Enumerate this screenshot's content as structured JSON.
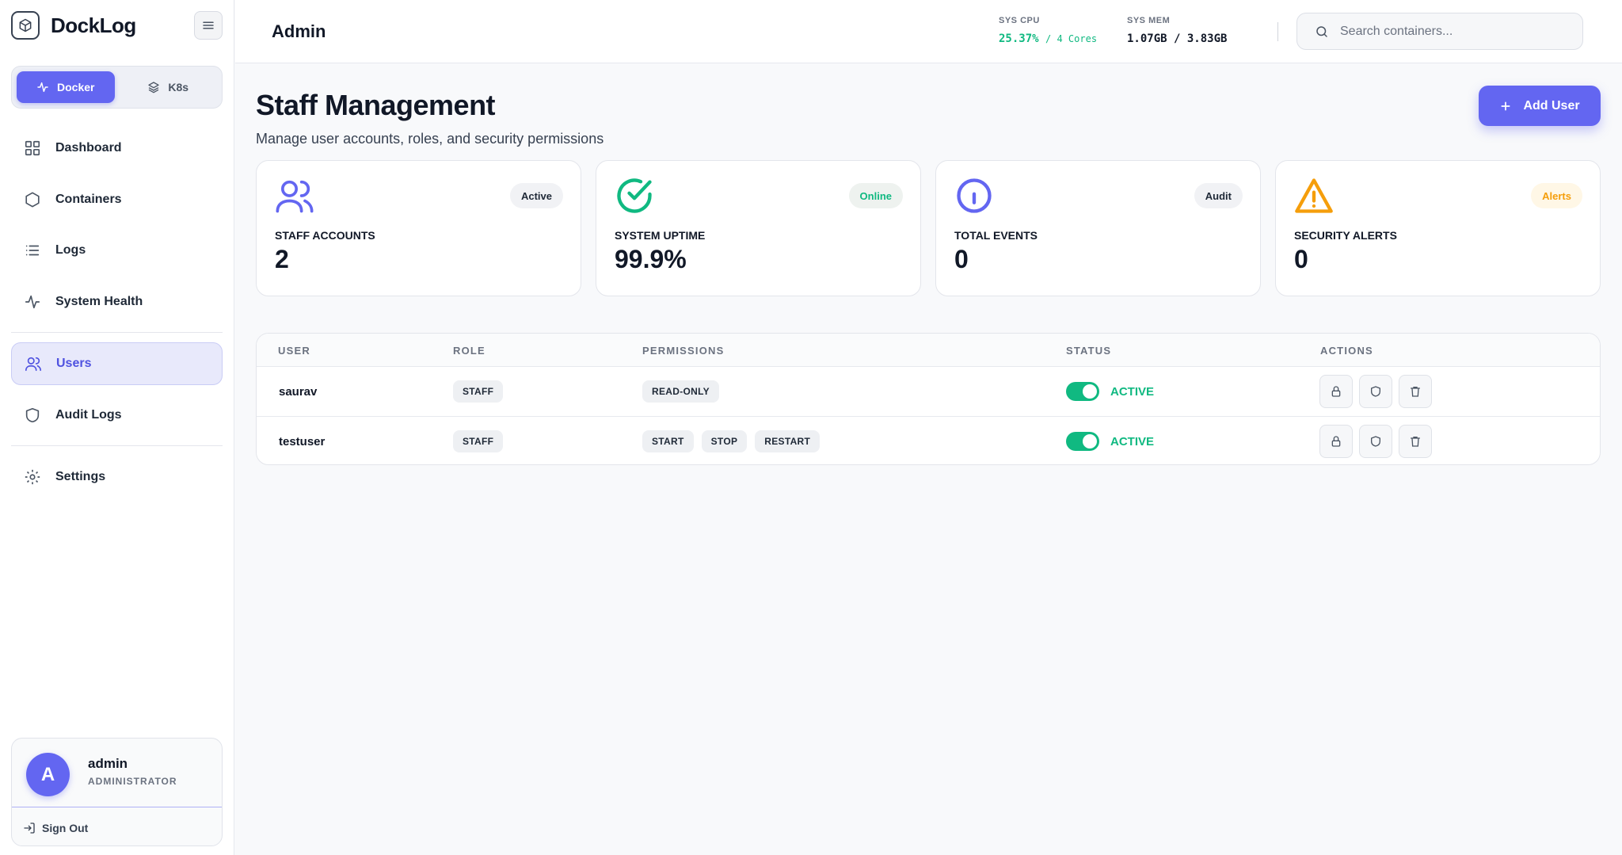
{
  "brand": {
    "name": "DockLog"
  },
  "modes": [
    {
      "label": "Docker",
      "active": true
    },
    {
      "label": "K8s",
      "active": false
    }
  ],
  "nav": {
    "items": [
      {
        "label": "Dashboard",
        "icon": "grid-icon"
      },
      {
        "label": "Containers",
        "icon": "hexagon-icon"
      },
      {
        "label": "Logs",
        "icon": "list-icon"
      },
      {
        "label": "System Health",
        "icon": "activity-icon"
      },
      {
        "label": "Users",
        "icon": "users-icon",
        "active": true
      },
      {
        "label": "Audit Logs",
        "icon": "shield-icon"
      },
      {
        "label": "Settings",
        "icon": "gear-icon"
      }
    ]
  },
  "user": {
    "initial": "A",
    "name": "admin",
    "role": "ADMINISTRATOR",
    "signout_label": "Sign Out"
  },
  "header": {
    "title": "Admin",
    "cpu_label": "SYS CPU",
    "cpu_value": "25.37%",
    "cpu_cores": "/ 4 Cores",
    "mem_label": "SYS MEM",
    "mem_value": "1.07GB / 3.83GB",
    "search_placeholder": "Search containers..."
  },
  "page": {
    "title": "Staff Management",
    "subtitle": "Manage user accounts, roles, and security permissions",
    "add_button": "Add User"
  },
  "stats": [
    {
      "label": "STAFF ACCOUNTS",
      "value": "2",
      "badge": "Active",
      "icon": "users-icon",
      "color": "#6366f1",
      "badge_bg": "#f1f2f5",
      "badge_color": "#1f2937"
    },
    {
      "label": "SYSTEM UPTIME",
      "value": "99.9%",
      "badge": "Online",
      "icon": "check-circle-icon",
      "color": "#10b981",
      "badge_bg": "#eef2ef",
      "badge_color": "#10b981"
    },
    {
      "label": "TOTAL EVENTS",
      "value": "0",
      "badge": "Audit",
      "icon": "info-circle-icon",
      "color": "#6366f1",
      "badge_bg": "#f1f2f5",
      "badge_color": "#1f2937"
    },
    {
      "label": "SECURITY ALERTS",
      "value": "0",
      "badge": "Alerts",
      "icon": "alert-triangle-icon",
      "color": "#f59e0b",
      "badge_bg": "#fff7e6",
      "badge_color": "#f59e0b"
    }
  ],
  "table": {
    "headers": [
      "USER",
      "ROLE",
      "PERMISSIONS",
      "STATUS",
      "ACTIONS"
    ],
    "rows": [
      {
        "user": "saurav",
        "role": "STAFF",
        "permissions": [
          "READ-ONLY"
        ],
        "status": "ACTIVE"
      },
      {
        "user": "testuser",
        "role": "STAFF",
        "permissions": [
          "START",
          "STOP",
          "RESTART"
        ],
        "status": "ACTIVE"
      }
    ]
  }
}
